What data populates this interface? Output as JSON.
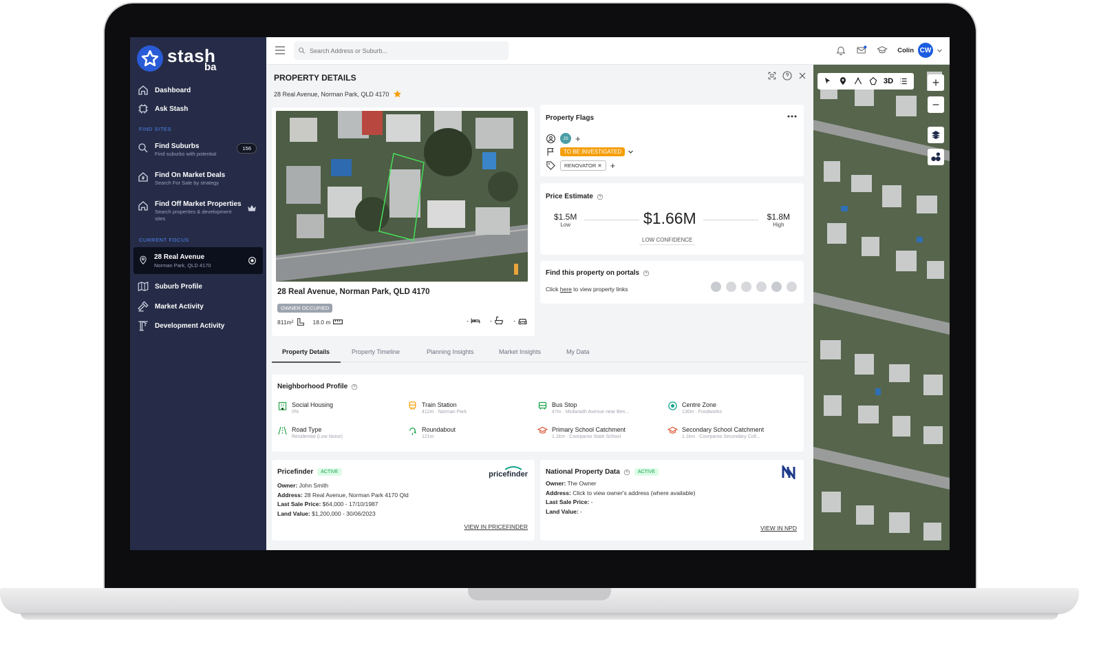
{
  "app": {
    "logo_text": "stash",
    "logo_sub": "ba"
  },
  "sidebar": {
    "items": [
      {
        "label": "Dashboard",
        "icon": "home-icon"
      },
      {
        "label": "Ask Stash",
        "icon": "chip-icon"
      }
    ],
    "find_sites_label": "FIND SITES",
    "find_sites": [
      {
        "label": "Find Suburbs",
        "sub": "Find suburbs with potential",
        "badge": "156",
        "icon": "search-icon"
      },
      {
        "label": "Find On Market Deals",
        "sub": "Search For Sale by strategy",
        "icon": "house-dollar-icon"
      },
      {
        "label": "Find Off Market Properties",
        "sub": "Search properties & development sites",
        "icon": "house-icon"
      }
    ],
    "current_focus_label": "CURRENT FOCUS",
    "focus": {
      "label": "28 Real Avenue",
      "sub": "Norman Park, QLD 4170"
    },
    "focus_items": [
      {
        "label": "Suburb Profile",
        "icon": "map-icon"
      },
      {
        "label": "Market Activity",
        "icon": "gavel-icon"
      },
      {
        "label": "Development Activity",
        "icon": "crane-icon"
      }
    ]
  },
  "topbar": {
    "search_placeholder": "Search Address or Suburb...",
    "user_name": "Colin",
    "user_initials": "CW"
  },
  "panel": {
    "title": "PROPERTY DETAILS",
    "address": "28 Real Avenue, Norman Park, QLD 4170"
  },
  "property_card": {
    "address": "28 Real Avenue, Norman Park, QLD 4170",
    "status": "OWNER OCCUPIED",
    "land_size": "811m²",
    "frontage": "18.0 m",
    "beds": "-",
    "baths": "-",
    "cars": "-"
  },
  "flags": {
    "title": "Property Flags",
    "user_initials": "JS",
    "status_flag": "TO BE INVESTIGATED",
    "tag": "RENOVATOR"
  },
  "price_estimate": {
    "title": "Price Estimate",
    "low": "$1.5M",
    "low_label": "Low",
    "mid": "$1.66M",
    "high": "$1.8M",
    "high_label": "High",
    "confidence": "LOW CONFIDENCE"
  },
  "portals": {
    "title": "Find this property on portals",
    "text_pre": "Click ",
    "link": "here",
    "text_post": " to view property links"
  },
  "tabs": [
    "Property Details",
    "Property Timeline",
    "Planning Insights",
    "Market Insights",
    "My Data"
  ],
  "neighborhood": {
    "title": "Neighborhood Profile",
    "items": [
      {
        "label": "Social Housing",
        "sub": "0%",
        "icon": "social-housing-icon"
      },
      {
        "label": "Train Station",
        "sub": "412m · Norman Park",
        "icon": "train-icon"
      },
      {
        "label": "Bus Stop",
        "sub": "47m · Mcilwraith Avenue near Ben...",
        "icon": "bus-icon"
      },
      {
        "label": "Centre Zone",
        "sub": "130m · Foodworks",
        "icon": "centre-zone-icon"
      },
      {
        "label": "Road Type",
        "sub": "Residential (Low Noise)",
        "icon": "road-icon"
      },
      {
        "label": "Roundabout",
        "sub": "121m",
        "icon": "roundabout-icon"
      },
      {
        "label": "Primary School Catchment",
        "sub": "1.1km · Coorparoo State School",
        "icon": "school-icon"
      },
      {
        "label": "Secondary School Catchment",
        "sub": "1.1km · Coorparoo Secondary Coll...",
        "icon": "school-icon"
      }
    ]
  },
  "pricefinder": {
    "title": "Pricefinder",
    "status": "ACTIVE",
    "brand": "pricefinder",
    "owner_label": "Owner:",
    "owner": " John Smith",
    "address_label": "Address:",
    "address": " 28 Real Avenue, Norman Park 4170 Qld",
    "last_sale_label": "Last Sale Price:",
    "last_sale": " $64,000 - 17/10/1987",
    "land_value_label": "Land Value:",
    "land_value": " $1,200,000 - 30/06/2023",
    "link": "VIEW IN PRICEFINDER"
  },
  "npd": {
    "title": "National Property Data",
    "status": "ACTIVE",
    "owner_label": "Owner:",
    "owner": " The Owner",
    "address_label": "Address:",
    "address": " Click to view owner's address (where available)",
    "last_sale_label": "Last Sale Price:",
    "last_sale": " -",
    "land_value_label": "Land Value:",
    "land_value": " -",
    "link": "VIEW IN NPD"
  },
  "map": {
    "tool_3d": "3D"
  },
  "colors": {
    "sidebar_bg": "#262c47",
    "accent": "#1d5be0",
    "flag_orange": "#f59e0b",
    "active_green": "#16a34a"
  }
}
